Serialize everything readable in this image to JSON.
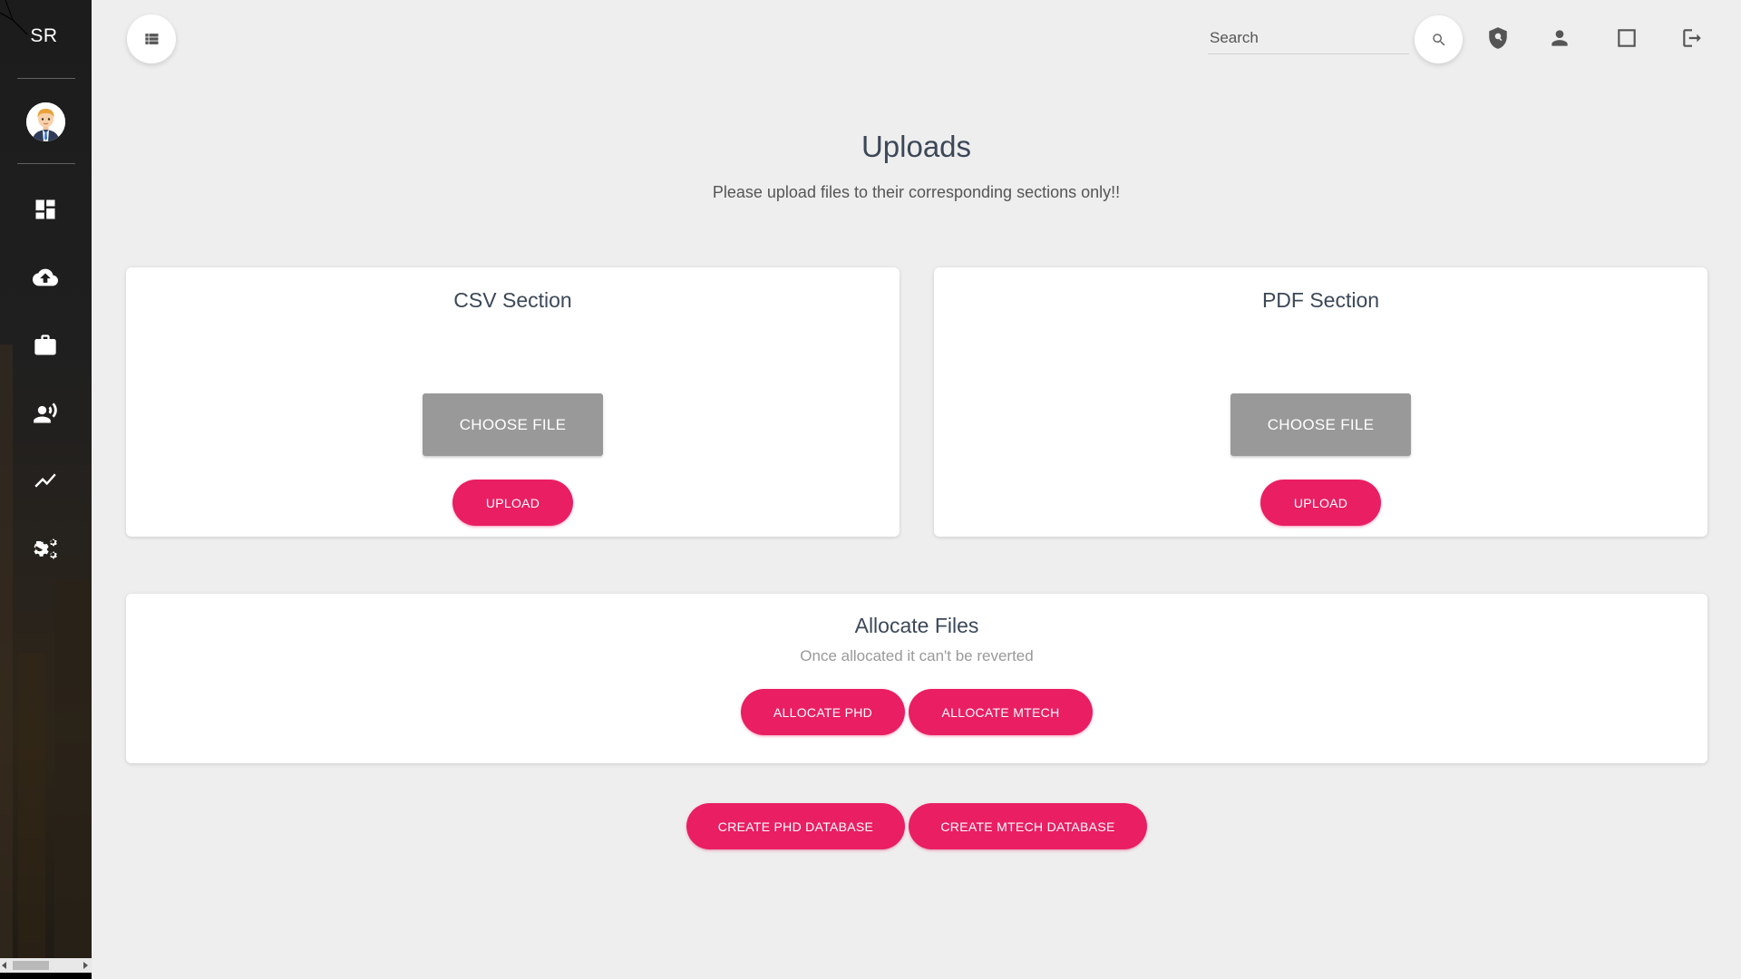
{
  "sidebar": {
    "logo": "SR",
    "nav": [
      {
        "icon": "dashboard-icon"
      },
      {
        "icon": "cloud-upload-icon"
      },
      {
        "icon": "briefcase-icon"
      },
      {
        "icon": "record-voice-icon"
      },
      {
        "icon": "trending-icon"
      },
      {
        "icon": "settings-icon"
      }
    ]
  },
  "topbar": {
    "search_placeholder": "Search",
    "icons": [
      "shield-icon",
      "person-icon",
      "fullscreen-icon",
      "logout-icon"
    ]
  },
  "page": {
    "title": "Uploads",
    "subtitle": "Please upload files to their corresponding sections only!!"
  },
  "csv_section": {
    "title": "CSV Section",
    "choose_label": "CHOOSE FILE",
    "upload_label": "UPLOAD"
  },
  "pdf_section": {
    "title": "PDF Section",
    "choose_label": "CHOOSE FILE",
    "upload_label": "UPLOAD"
  },
  "allocate": {
    "title": "Allocate Files",
    "subtitle": "Once allocated it can't be reverted",
    "phd_label": "ALLOCATE PHD",
    "mtech_label": "ALLOCATE MTECH"
  },
  "database": {
    "phd_label": "CREATE PHD DATABASE",
    "mtech_label": "CREATE MTECH DATABASE"
  },
  "colors": {
    "accent": "#e91e63",
    "choose_button": "#999999",
    "sidebar_bg": "#1f1f1f",
    "page_bg": "#eeeeee"
  }
}
